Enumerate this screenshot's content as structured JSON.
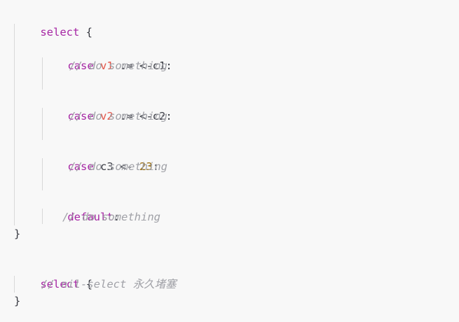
{
  "code": {
    "block1": {
      "open_kw": "select",
      "open_brace": " {",
      "case1_kw": "case",
      "case1_var": "v1",
      "case1_op": " := <-c1:",
      "case1_comment": "// do something",
      "case2_kw": "case",
      "case2_var": "v2",
      "case2_op": " := <-c2:",
      "case2_comment": "// do something",
      "case3_kw": "case",
      "case3_mid": " c3 <- ",
      "case3_num": "23",
      "case3_colon": ":",
      "case3_comment": "// do something",
      "default_kw": "default",
      "default_colon": ":",
      "default_comment": "// do something",
      "close_brace": "}"
    },
    "block2": {
      "open_kw": "select",
      "open_brace": " {",
      "comment": "// nil-select 永久堵塞",
      "close_brace": "}"
    }
  },
  "colors": {
    "background": "#f8f8f8",
    "keyword": "#a626a4",
    "variable": "#e45649",
    "number": "#986801",
    "comment": "#a0a1a7",
    "text": "#383a42"
  }
}
